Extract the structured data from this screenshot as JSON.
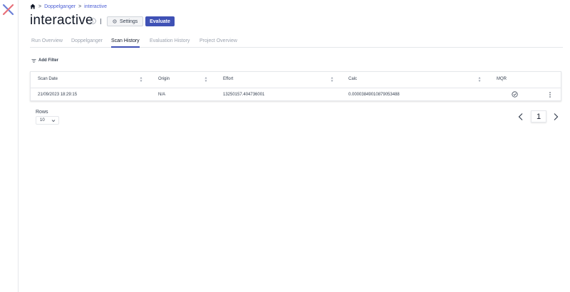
{
  "breadcrumb": {
    "items": [
      "Doppelganger",
      "interactive"
    ],
    "separator": ">"
  },
  "page": {
    "title": "interactive"
  },
  "header": {
    "settings_label": "Settings",
    "evaluate_label": "Evaluate"
  },
  "tabs": [
    {
      "label": "Run Overview",
      "active": false
    },
    {
      "label": "Doppelganger",
      "active": false
    },
    {
      "label": "Scan History",
      "active": true
    },
    {
      "label": "Evaluation History",
      "active": false
    },
    {
      "label": "Project Overview",
      "active": false
    }
  ],
  "filter": {
    "add_label": "Add Filter"
  },
  "table": {
    "columns": [
      "Scan Date",
      "Origin",
      "Effort",
      "Calc",
      "MQR"
    ],
    "rows": [
      {
        "scan_date": "21/09/2023 18:29:15",
        "origin": "N/A",
        "effort": "13250157.404736001",
        "calc": "0.00003849010879053488",
        "mqr_icon": "check-circle-icon"
      }
    ]
  },
  "pagination": {
    "rows_label": "Rows",
    "rows_value": "10",
    "current_page": "1"
  },
  "colors": {
    "accent": "#3f51b5",
    "link": "#4c5fd5",
    "logo_red": "#e8707a",
    "logo_blue": "#6b7fd7"
  }
}
